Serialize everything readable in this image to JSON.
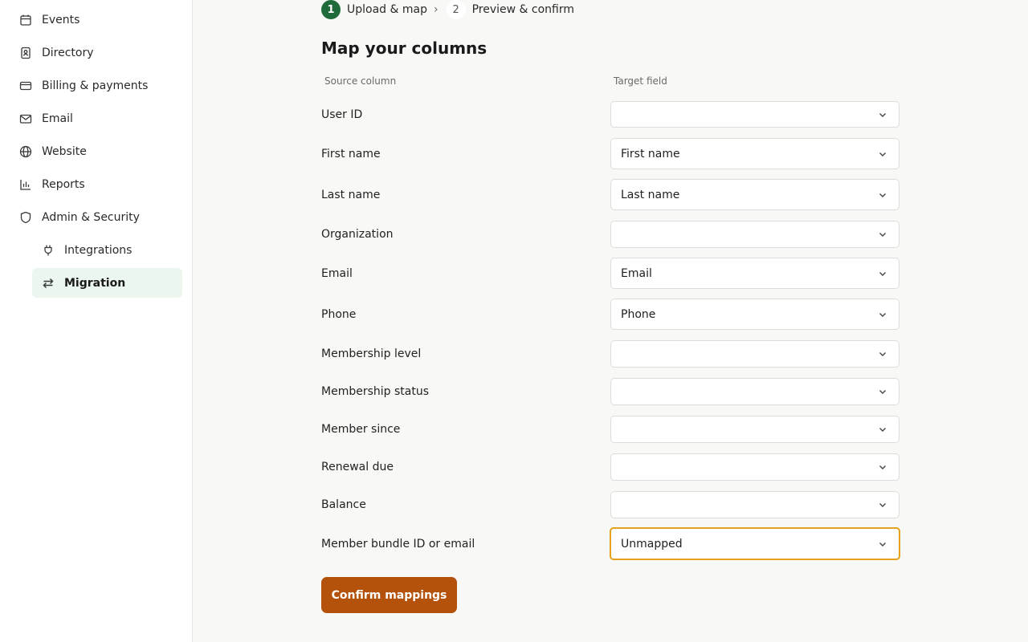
{
  "sidebar": {
    "items": [
      {
        "label": "Events",
        "icon": "calendar-icon"
      },
      {
        "label": "Directory",
        "icon": "contact-book-icon"
      },
      {
        "label": "Billing & payments",
        "icon": "credit-card-icon"
      },
      {
        "label": "Email",
        "icon": "mail-icon"
      },
      {
        "label": "Website",
        "icon": "globe-icon"
      },
      {
        "label": "Reports",
        "icon": "bar-chart-icon"
      },
      {
        "label": "Admin & Security",
        "icon": "shield-icon"
      },
      {
        "label": "Integrations",
        "icon": "plug-icon"
      },
      {
        "label": "Migration",
        "icon": "arrows-swap-icon",
        "active": true
      }
    ]
  },
  "stepper": {
    "step1_num": "1",
    "step1_label": "Upload & map",
    "separator": "›",
    "step2_num": "2",
    "step2_label": "Preview & confirm"
  },
  "main": {
    "title": "Map your columns",
    "source_header": "Source column",
    "target_header": "Target field",
    "rows": [
      {
        "source": "User ID",
        "target": ""
      },
      {
        "source": "First name",
        "target": "First name"
      },
      {
        "source": "Last name",
        "target": "Last name"
      },
      {
        "source": "Organization",
        "target": ""
      },
      {
        "source": "Email",
        "target": "Email"
      },
      {
        "source": "Phone",
        "target": "Phone"
      },
      {
        "source": "Membership level",
        "target": ""
      },
      {
        "source": "Membership status",
        "target": ""
      },
      {
        "source": "Member since",
        "target": ""
      },
      {
        "source": "Renewal due",
        "target": ""
      },
      {
        "source": "Balance",
        "target": ""
      },
      {
        "source": "Member bundle ID or email",
        "target": "Unmapped",
        "focused": true
      }
    ],
    "confirm_label": "Confirm mappings"
  },
  "colors": {
    "accent": "#b4510b",
    "step_active": "#1f6b3a",
    "active_nav_bg": "#ebf7ee",
    "focus_ring": "#e5a11c"
  }
}
